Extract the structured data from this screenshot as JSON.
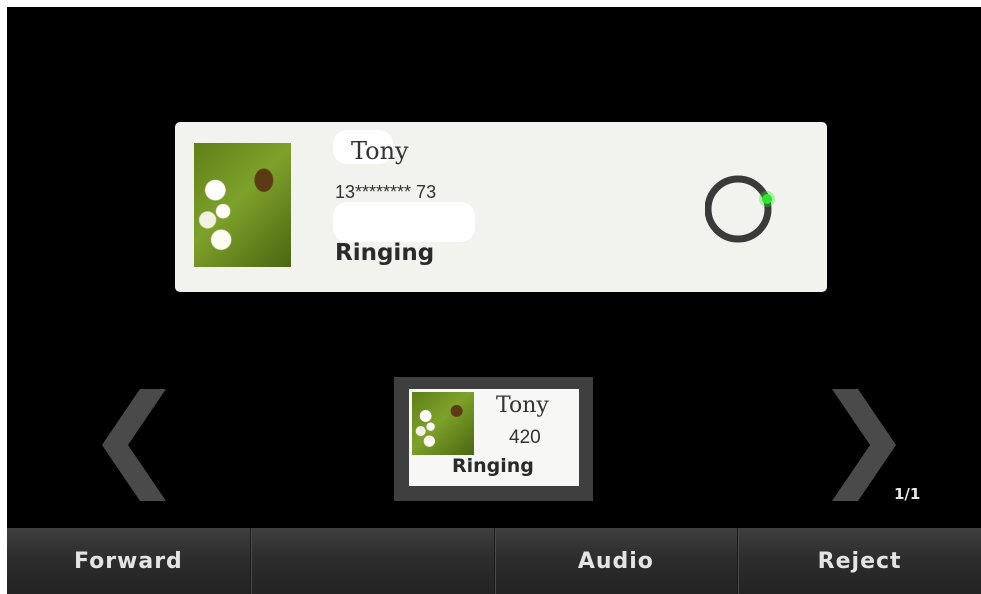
{
  "call_card": {
    "name": "Tony",
    "number": "13******** 73",
    "status": "Ringing"
  },
  "thumbnail": {
    "name": "Tony",
    "number": "420",
    "status": "Ringing"
  },
  "pager": {
    "page": "1/1"
  },
  "softkeys": {
    "key1": "Forward",
    "key2": "",
    "key3": "Audio",
    "key4": "Reject"
  },
  "colors": {
    "background": "#000000",
    "card": "#f2f2ef",
    "ring_dot": "#2ee62e",
    "softkey_bar": "#2d2d2d"
  }
}
